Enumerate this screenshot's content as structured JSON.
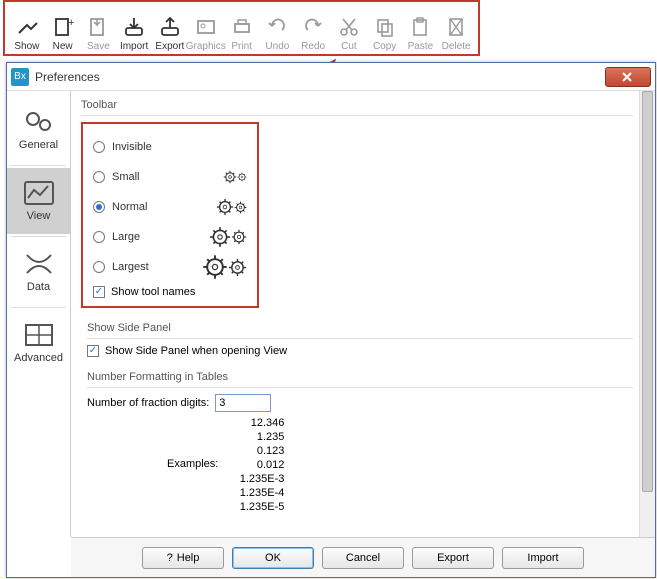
{
  "toolbar_items": [
    {
      "label": "Show",
      "enabled": true
    },
    {
      "label": "New",
      "enabled": true
    },
    {
      "label": "Save",
      "enabled": false
    },
    {
      "label": "Import",
      "enabled": true
    },
    {
      "label": "Export",
      "enabled": true
    },
    {
      "label": "Graphics",
      "enabled": false
    },
    {
      "label": "Print",
      "enabled": false
    },
    {
      "label": "Undo",
      "enabled": false
    },
    {
      "label": "Redo",
      "enabled": false
    },
    {
      "label": "Cut",
      "enabled": false
    },
    {
      "label": "Copy",
      "enabled": false
    },
    {
      "label": "Paste",
      "enabled": false
    },
    {
      "label": "Delete",
      "enabled": false
    }
  ],
  "dialog": {
    "title": "Preferences",
    "tabs": [
      "General",
      "View",
      "Data",
      "Advanced"
    ],
    "active_tab": "View",
    "toolbar_section": {
      "heading": "Toolbar",
      "options": [
        "Invisible",
        "Small",
        "Normal",
        "Large",
        "Largest"
      ],
      "selected": "Normal",
      "show_tool_names_label": "Show tool names",
      "show_tool_names_checked": true
    },
    "side_panel_section": {
      "heading": "Show Side Panel",
      "checkbox_label": "Show Side Panel when opening View",
      "checked": true
    },
    "number_format_section": {
      "heading": "Number Formatting in Tables",
      "field_label": "Number of fraction digits:",
      "field_value": "3",
      "examples_label": "Examples:",
      "examples": [
        "12.346",
        "1.235",
        "0.123",
        "0.012",
        "1.235E-3",
        "1.235E-4",
        "1.235E-5"
      ]
    },
    "buttons": {
      "help": "Help",
      "ok": "OK",
      "cancel": "Cancel",
      "export": "Export",
      "import": "Import"
    }
  }
}
